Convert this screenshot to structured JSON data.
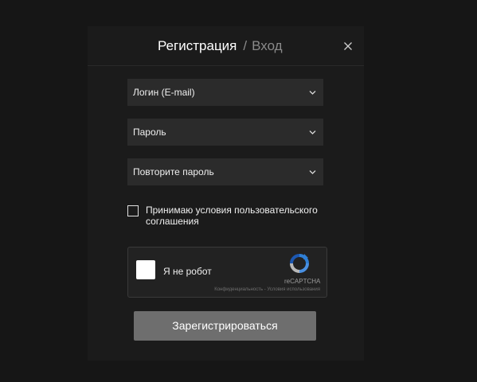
{
  "header": {
    "tab_register": "Регистрация",
    "separator": "/",
    "tab_login": "Вход"
  },
  "fields": [
    {
      "label": "Логин (E-mail)",
      "icon": "chevron-down-icon"
    },
    {
      "label": "Пароль",
      "icon": "chevron-down-icon"
    },
    {
      "label": "Повторите пароль",
      "icon": "chevron-down-icon"
    }
  ],
  "agree": {
    "label": "Принимаю условия пользовательского соглашения",
    "checked": false
  },
  "captcha": {
    "label": "Я не робот",
    "brand": "reCAPTCHA",
    "links": "Конфиденциальность - Условия использования",
    "checked": false
  },
  "submit_label": "Зарегистрироваться",
  "colors": {
    "background": "#161616",
    "modal": "#1b1b1b",
    "field": "#2b2b2b",
    "button": "#6e6e6e",
    "recaptcha_blue": "#2f7fd6"
  }
}
